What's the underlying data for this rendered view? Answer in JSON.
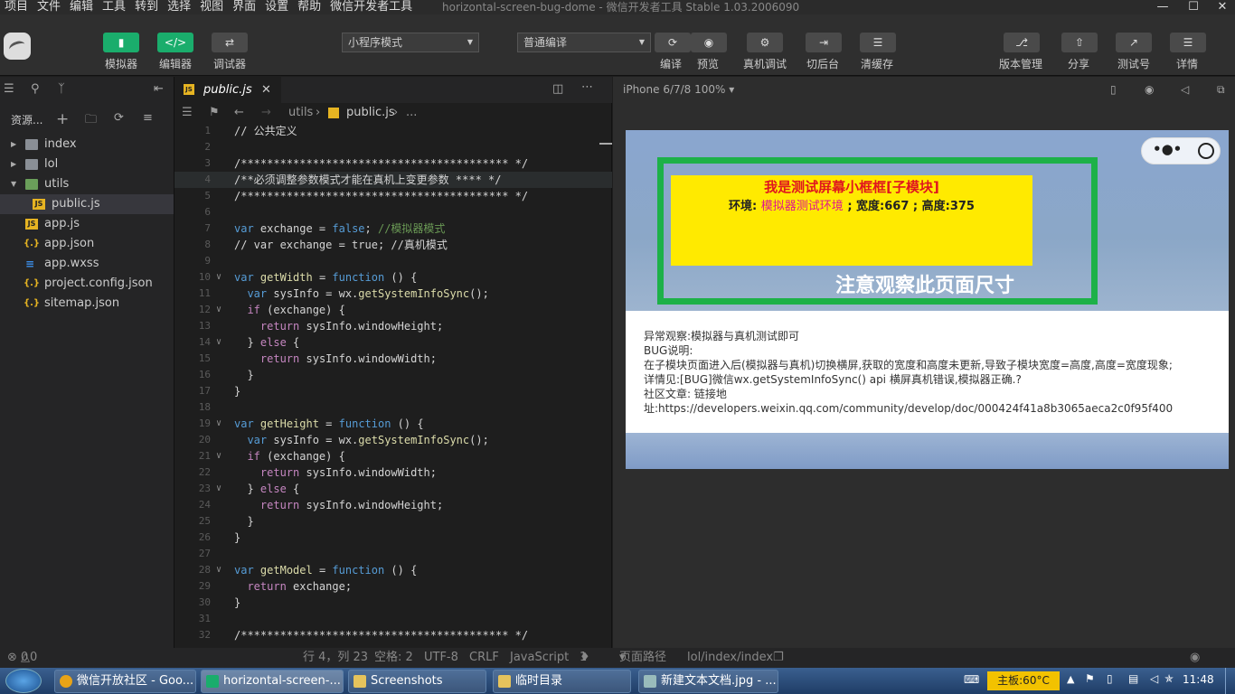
{
  "menu": [
    "项目",
    "文件",
    "编辑",
    "工具",
    "转到",
    "选择",
    "视图",
    "界面",
    "设置",
    "帮助",
    "微信开发者工具"
  ],
  "window_title": "horizontal-screen-bug-dome - 微信开发者工具 Stable 1.03.2006090",
  "toolbar": {
    "simulator": "模拟器",
    "editor": "编辑器",
    "debugger": "调试器",
    "mode_select": "小程序模式",
    "compile_select": "普通编译",
    "compile": "编译",
    "preview": "预览",
    "real_debug": "真机调试",
    "background": "切后台",
    "clear_cache": "清缓存",
    "version": "版本管理",
    "share": "分享",
    "test_id": "测试号",
    "details": "详情"
  },
  "explorer": {
    "title": "资源...",
    "items": [
      {
        "label": "index",
        "type": "folder"
      },
      {
        "label": "lol",
        "type": "folder"
      },
      {
        "label": "utils",
        "type": "folder-open"
      },
      {
        "label": "public.js",
        "type": "js"
      },
      {
        "label": "app.js",
        "type": "js"
      },
      {
        "label": "app.json",
        "type": "json"
      },
      {
        "label": "app.wxss",
        "type": "wxss"
      },
      {
        "label": "project.config.json",
        "type": "json"
      },
      {
        "label": "sitemap.json",
        "type": "json"
      }
    ]
  },
  "editor": {
    "tab_label": "public.js",
    "breadcrumb": [
      "utils",
      "public.js",
      "..."
    ],
    "lines": [
      {
        "n": "1",
        "t": "// 公共定义"
      },
      {
        "n": "2",
        "t": ""
      },
      {
        "n": "3",
        "t": "/***************************************** */"
      },
      {
        "n": "4",
        "t": "/**必须调整参数模式才能在真机上变更参数 **** */"
      },
      {
        "n": "5",
        "t": "/***************************************** */"
      },
      {
        "n": "6",
        "t": ""
      },
      {
        "n": "7",
        "t": "var exchange = false; //模拟器模式"
      },
      {
        "n": "8",
        "t": "// var exchange = true; //真机模式"
      },
      {
        "n": "9",
        "t": ""
      },
      {
        "n": "10",
        "t": "var getWidth = function () {"
      },
      {
        "n": "11",
        "t": "  var sysInfo = wx.getSystemInfoSync();"
      },
      {
        "n": "12",
        "t": "  if (exchange) {"
      },
      {
        "n": "13",
        "t": "    return sysInfo.windowHeight;"
      },
      {
        "n": "14",
        "t": "  } else {"
      },
      {
        "n": "15",
        "t": "    return sysInfo.windowWidth;"
      },
      {
        "n": "16",
        "t": "  }"
      },
      {
        "n": "17",
        "t": "}"
      },
      {
        "n": "18",
        "t": ""
      },
      {
        "n": "19",
        "t": "var getHeight = function () {"
      },
      {
        "n": "20",
        "t": "  var sysInfo = wx.getSystemInfoSync();"
      },
      {
        "n": "21",
        "t": "  if (exchange) {"
      },
      {
        "n": "22",
        "t": "    return sysInfo.windowWidth;"
      },
      {
        "n": "23",
        "t": "  } else {"
      },
      {
        "n": "24",
        "t": "    return sysInfo.windowHeight;"
      },
      {
        "n": "25",
        "t": "  }"
      },
      {
        "n": "26",
        "t": "}"
      },
      {
        "n": "27",
        "t": ""
      },
      {
        "n": "28",
        "t": "var getModel = function () {"
      },
      {
        "n": "29",
        "t": "  return exchange;"
      },
      {
        "n": "30",
        "t": "}"
      },
      {
        "n": "31",
        "t": ""
      },
      {
        "n": "32",
        "t": "/***************************************** */"
      }
    ]
  },
  "simulator": {
    "device": "iPhone 6/7/8 100%",
    "box_title": "我是测试屏幕小框框[子模块]",
    "env_label": "环境:",
    "env_value": "模拟器测试环境",
    "size_text": "; 宽度:667 ; 高度:375",
    "notice": "注意观察此页面尺寸",
    "desc_lines": [
      "异常观察:模拟器与真机测试即可",
      "BUG说明:",
      "在子模块页面进入后(模拟器与真机)切换横屏,获取的宽度和高度未更新,导致子模块宽度=高度,高度=宽度现象;",
      "详情见:[BUG]微信wx.getSystemInfoSync() api 横屏真机错误,模拟器正确.?",
      "社区文章: 链接地",
      "址:https://developers.weixin.qq.com/community/develop/doc/000424f41a8b3065aeca2c0f95f400"
    ]
  },
  "statusbar": {
    "errors": "0",
    "warnings": "0",
    "position": "行 4，列 23",
    "spaces": "空格: 2",
    "encoding": "UTF-8",
    "eol": "CRLF",
    "language": "JavaScript",
    "notifications": "1",
    "page_path_label": "页面路径",
    "page_path": "lol/index/index"
  },
  "taskbar": {
    "tasks": [
      {
        "label": "微信开放社区 - Goo...",
        "color": "#e8a317"
      },
      {
        "label": "horizontal-screen-...",
        "color": "#1aad6c"
      },
      {
        "label": "Screenshots",
        "color": "#e6c35c"
      },
      {
        "label": "临时目录",
        "color": "#e6c35c"
      },
      {
        "label": "新建文本文档.jpg - ...",
        "color": "#9bb"
      }
    ],
    "temp": "主板:60°C",
    "time": "11:48"
  }
}
